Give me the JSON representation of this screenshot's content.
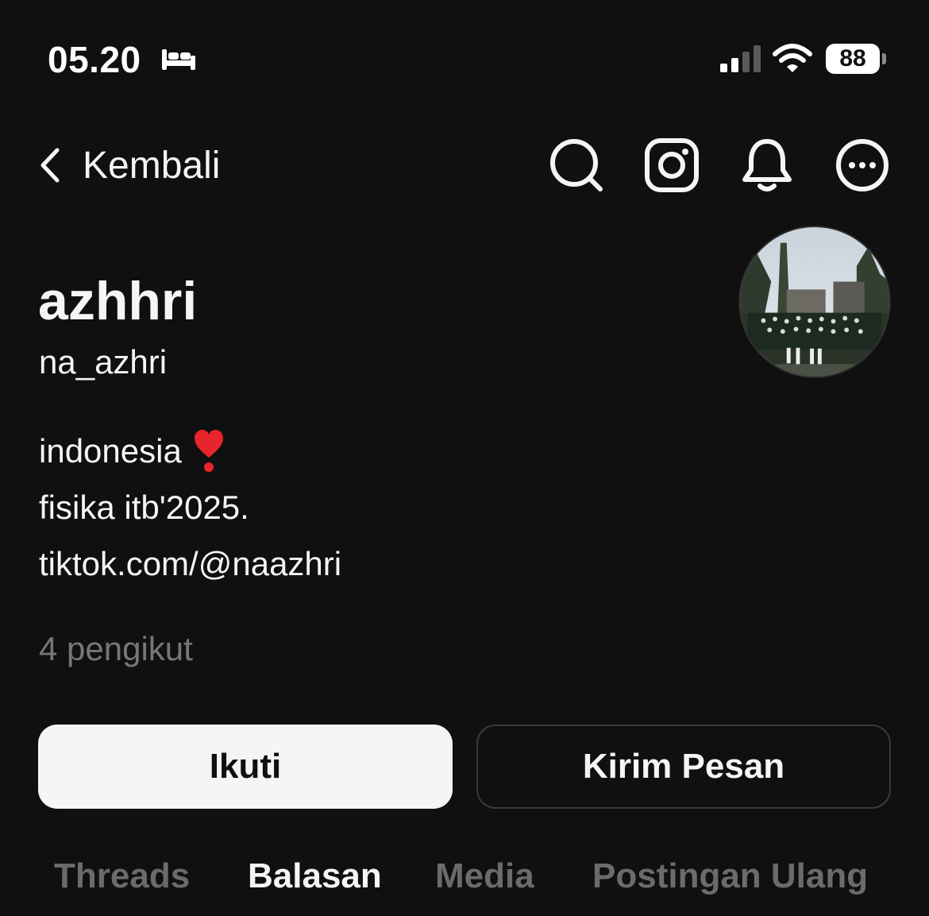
{
  "status_bar": {
    "time": "05.20",
    "battery": "88"
  },
  "nav": {
    "back_label": "Kembali"
  },
  "profile": {
    "display_name": "azhhri",
    "username": "na_azhri",
    "bio_lines": [
      "indonesia",
      "fisika itb'2025.",
      "tiktok.com/@naazhri"
    ],
    "followers": "4 pengikut"
  },
  "actions": {
    "follow_label": "Ikuti",
    "message_label": "Kirim Pesan"
  },
  "tabs": [
    {
      "label": "Threads",
      "active": false
    },
    {
      "label": "Balasan",
      "active": true
    },
    {
      "label": "Media",
      "active": false
    },
    {
      "label": "Postingan Ulang",
      "active": false
    }
  ],
  "colors": {
    "background": "#101010",
    "text_primary": "#f3f5f7",
    "text_muted": "#777777",
    "follow_button_bg": "#f3f5f7",
    "heart": "#e8242d"
  },
  "icons": [
    "sleep-icon",
    "signal-icon",
    "wifi-icon",
    "battery-icon",
    "back-chevron-icon",
    "search-icon",
    "instagram-icon",
    "bell-icon",
    "more-icon",
    "heart-exclamation-icon"
  ]
}
